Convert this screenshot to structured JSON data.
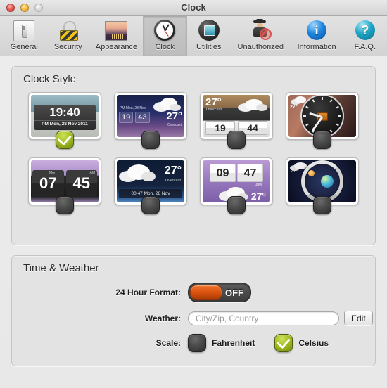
{
  "window": {
    "title": "Clock",
    "controls": [
      {
        "name": "close",
        "label": "close-button"
      },
      {
        "name": "minimize",
        "label": "minimize-button"
      },
      {
        "name": "zoom",
        "label": "zoom-button"
      }
    ]
  },
  "toolbar": {
    "selected": "Clock",
    "items": [
      {
        "label": "General",
        "icon": "switch-panel-icon"
      },
      {
        "label": "Security",
        "icon": "padlock-icon"
      },
      {
        "label": "Appearance",
        "icon": "sunset-photo-icon"
      },
      {
        "label": "Clock",
        "icon": "analog-clock-icon"
      },
      {
        "label": "Utilities",
        "icon": "toolbox-window-icon"
      },
      {
        "label": "Unauthorized",
        "icon": "spy-blocked-icon"
      },
      {
        "label": "Information",
        "icon": "info-circle-icon"
      },
      {
        "label": "F.A.Q.",
        "icon": "question-circle-icon"
      }
    ]
  },
  "clock_style": {
    "title": "Clock Style",
    "styles": [
      {
        "id": "style-1",
        "selected": true,
        "variant": "t1",
        "time": "19:40",
        "subtitle": "PM Mon, 28 Nov 2011"
      },
      {
        "id": "style-2",
        "selected": false,
        "variant": "t2",
        "date": "PM Mon, 28 Nov",
        "hour": "19",
        "minute": "43",
        "temp": "27°",
        "condition": "Overcast"
      },
      {
        "id": "style-3",
        "selected": false,
        "variant": "t3",
        "temp": "27°",
        "condition": "Overcast",
        "hour": "19",
        "minute": "44"
      },
      {
        "id": "style-4",
        "selected": false,
        "variant": "t4",
        "temp": "27°"
      },
      {
        "id": "style-5",
        "selected": false,
        "variant": "t5",
        "hour": "07",
        "minute": "45",
        "dayofweek": "Mon",
        "ampm": "AM"
      },
      {
        "id": "style-6",
        "selected": false,
        "variant": "t6",
        "temp": "27°",
        "condition": "Overcast",
        "datetime": "00:47 Mon, 28 Nov"
      },
      {
        "id": "style-7",
        "selected": false,
        "variant": "t7",
        "hour": "09",
        "minute": "47",
        "ampm": "AM",
        "temp": "27°"
      },
      {
        "id": "style-8",
        "selected": false,
        "variant": "t8",
        "temp": "27°"
      }
    ]
  },
  "time_weather": {
    "title": "Time & Weather",
    "hour_format": {
      "label": "24 Hour Format:",
      "state_label": "OFF",
      "on": false
    },
    "weather": {
      "label": "Weather:",
      "placeholder": "City/Zip, Country",
      "value": "",
      "edit_label": "Edit"
    },
    "scale": {
      "label": "Scale:",
      "options": [
        {
          "label": "Fahrenheit",
          "selected": false
        },
        {
          "label": "Celsius",
          "selected": true
        }
      ]
    }
  },
  "colors": {
    "accent_orange": "#d6500d",
    "selected_green": "#a3bf22",
    "panel_bg": "#e3e3e3",
    "toolbar_bg": "#dadada"
  }
}
